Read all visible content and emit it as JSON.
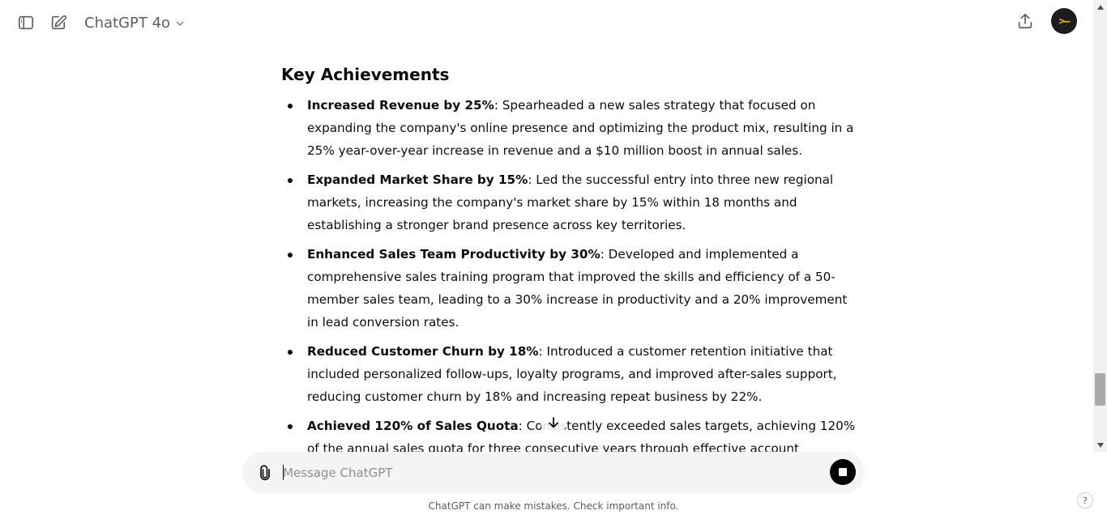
{
  "header": {
    "model_name": "ChatGPT 4o",
    "avatar_text": ">—"
  },
  "content": {
    "section_title": "Key Achievements",
    "items": [
      {
        "bold": "Increased Revenue by 25%",
        "text": ": Spearheaded a new sales strategy that focused on expanding the company's online presence and optimizing the product mix, resulting in a 25% year-over-year increase in revenue and a $10 million boost in annual sales."
      },
      {
        "bold": "Expanded Market Share by 15%",
        "text": ": Led the successful entry into three new regional markets, increasing the company's market share by 15% within 18 months and establishing a stronger brand presence across key territories."
      },
      {
        "bold": "Enhanced Sales Team Productivity by 30%",
        "text": ": Developed and implemented a comprehensive sales training program that improved the skills and efficiency of a 50-member sales team, leading to a 30% increase in productivity and a 20% improvement in lead conversion rates."
      },
      {
        "bold": "Reduced Customer Churn by 18%",
        "text": ": Introduced a customer retention initiative that included personalized follow-ups, loyalty programs, and improved after-sales support, reducing customer churn by 18% and increasing repeat business by 22%."
      },
      {
        "bold": "Achieved 120% of Sales Quota",
        "text": ": Consistently exceeded sales targets, achieving 120% of the annual sales quota for three consecutive years through effective account management, upselling, and cross-selling strategies."
      }
    ]
  },
  "composer": {
    "placeholder": "Message ChatGPT"
  },
  "footer": {
    "disclaimer": "ChatGPT can make mistakes. Check important info.",
    "help": "?"
  }
}
